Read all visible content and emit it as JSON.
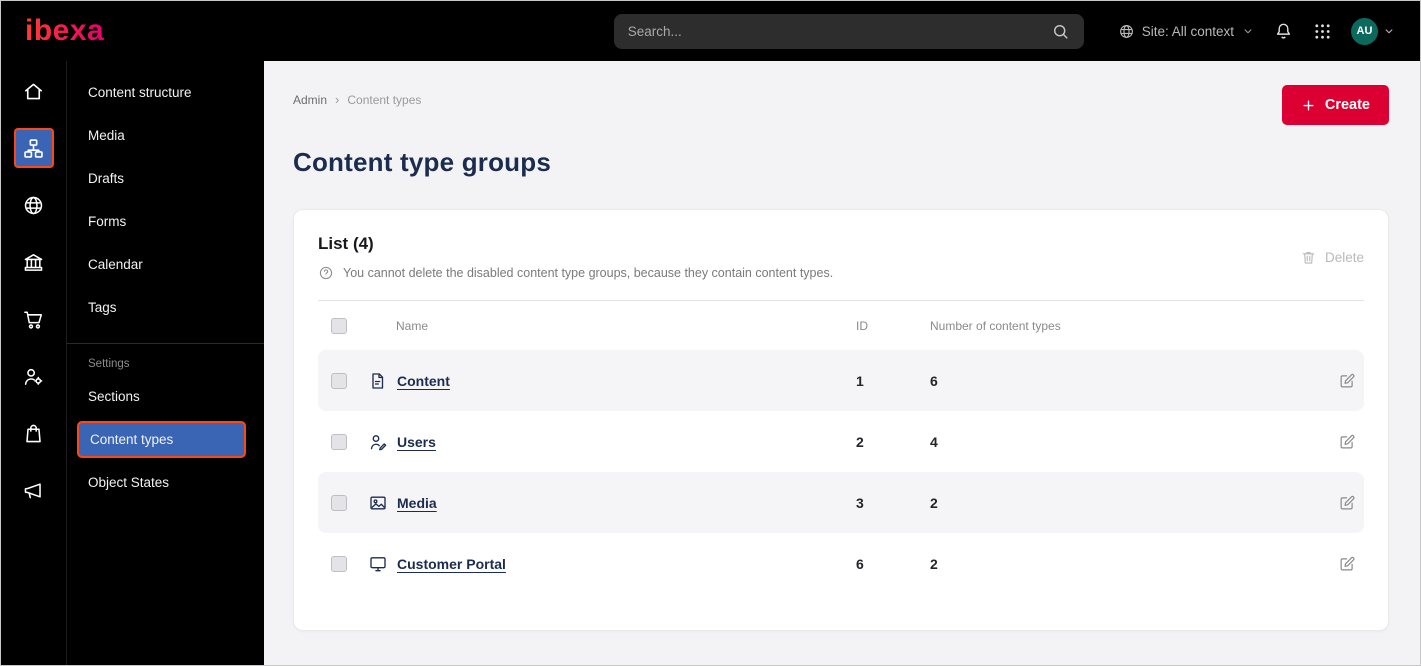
{
  "topbar": {
    "logo": "ibexa",
    "search": {
      "placeholder": "Search..."
    },
    "site_context": "Site: All context",
    "avatar_initials": "AU"
  },
  "icon_rail": {
    "icons": [
      "home-icon",
      "content-tree-icon",
      "site-globe-icon",
      "company-icon",
      "commerce-cart-icon",
      "permissions-user-gear-icon",
      "products-bag-icon",
      "marketing-megaphone-icon"
    ],
    "active_icon": "content-tree-icon"
  },
  "sidebar": {
    "items": [
      "Content structure",
      "Media",
      "Drafts",
      "Forms",
      "Calendar",
      "Tags"
    ],
    "section_label": "Settings",
    "settings_items": [
      "Sections",
      "Content types",
      "Object States"
    ],
    "active_item": "Content types"
  },
  "breadcrumb": {
    "items": [
      "Admin",
      "Content types"
    ],
    "separator": "›"
  },
  "page": {
    "title": "Content type groups",
    "create_label": "Create"
  },
  "list": {
    "heading": "List (4)",
    "info_text": "You cannot delete the disabled content type groups, because they contain content types.",
    "delete_label": "Delete",
    "columns": {
      "name": "Name",
      "id": "ID",
      "count": "Number of content types"
    },
    "rows": [
      {
        "name": "Content",
        "id": "1",
        "count": "6",
        "icon": "content-group-icon"
      },
      {
        "name": "Users",
        "id": "2",
        "count": "4",
        "icon": "users-group-icon"
      },
      {
        "name": "Media",
        "id": "3",
        "count": "2",
        "icon": "media-group-icon"
      },
      {
        "name": "Customer Portal",
        "id": "6",
        "count": "2",
        "icon": "portal-group-icon"
      }
    ]
  },
  "colors": {
    "accent_red": "#dc0032",
    "active_blue": "#3a65b5",
    "highlight_orange": "#ff4713",
    "avatar_bg": "#0c695d"
  }
}
